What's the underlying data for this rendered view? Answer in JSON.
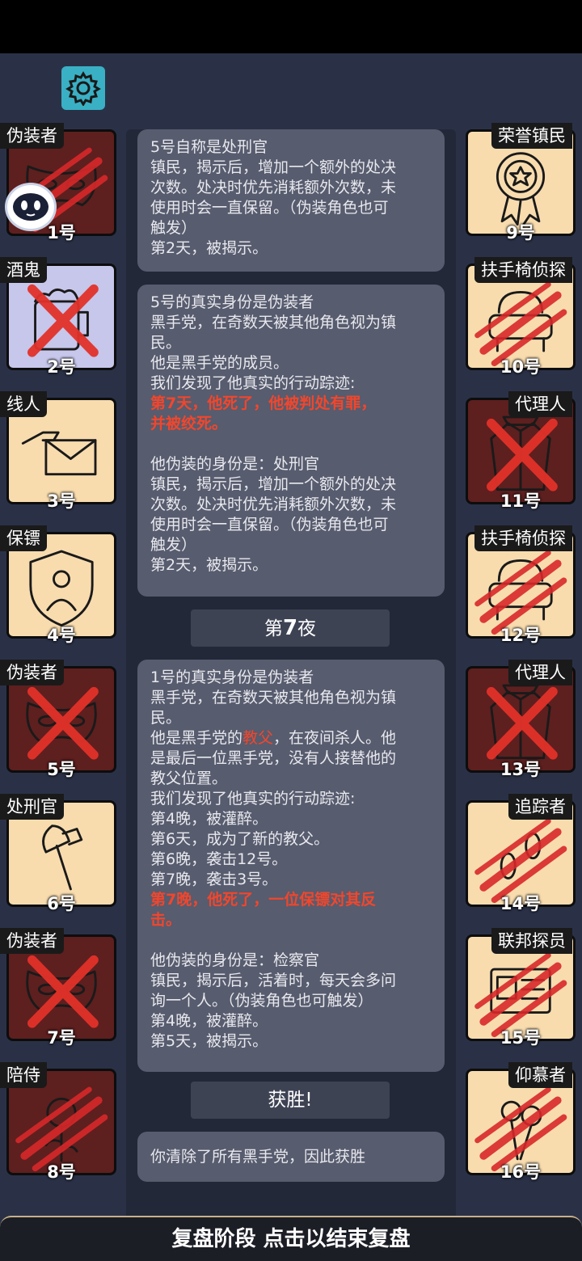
{
  "left_players": [
    {
      "role": "伪装者",
      "number": "1号",
      "state": "dead",
      "icon": "mask-icon",
      "mark": "claw"
    },
    {
      "role": "酒鬼",
      "number": "2号",
      "state": "drunk",
      "icon": "beer-mug-icon",
      "mark": "x"
    },
    {
      "role": "线人",
      "number": "3号",
      "state": "alive",
      "icon": "envelope-hand-icon",
      "mark": "none"
    },
    {
      "role": "保镖",
      "number": "4号",
      "state": "alive",
      "icon": "shield-person-icon",
      "mark": "none"
    },
    {
      "role": "伪装者",
      "number": "5号",
      "state": "dead",
      "icon": "mask-icon",
      "mark": "x"
    },
    {
      "role": "处刑官",
      "number": "6号",
      "state": "alive",
      "icon": "axe-icon",
      "mark": "none"
    },
    {
      "role": "伪装者",
      "number": "7号",
      "state": "dead",
      "icon": "mask-icon",
      "mark": "x"
    },
    {
      "role": "陪侍",
      "number": "8号",
      "state": "dead",
      "icon": "rose-icon",
      "mark": "claw"
    }
  ],
  "right_players": [
    {
      "role": "荣誉镇民",
      "number": "9号",
      "state": "alive",
      "icon": "medal-icon",
      "mark": "none"
    },
    {
      "role": "扶手椅侦探",
      "number": "10号",
      "state": "alive",
      "icon": "armchair-icon",
      "mark": "claw"
    },
    {
      "role": "代理人",
      "number": "11号",
      "state": "dead",
      "icon": "coat-icon",
      "mark": "x"
    },
    {
      "role": "扶手椅侦探",
      "number": "12号",
      "state": "alive",
      "icon": "armchair-icon",
      "mark": "claw"
    },
    {
      "role": "代理人",
      "number": "13号",
      "state": "dead",
      "icon": "coat-icon",
      "mark": "x"
    },
    {
      "role": "追踪者",
      "number": "14号",
      "state": "alive",
      "icon": "footprints-icon",
      "mark": "claw"
    },
    {
      "role": "联邦探员",
      "number": "15号",
      "state": "alive",
      "icon": "badge-icon",
      "mark": "claw"
    },
    {
      "role": "仰慕者",
      "number": "16号",
      "state": "alive",
      "icon": "flowers-icon",
      "mark": "claw"
    }
  ],
  "log": {
    "bubble1": [
      "5号自称是处刑官",
      "镇民，揭示后，增加一个额外的处决",
      "次数。处决时优先消耗额外次数，未",
      "使用时会一直保留。（伪装角色也可",
      "触发）",
      "第2天，被揭示。"
    ],
    "bubble2_top": [
      "5号的真实身份是伪装者",
      "黑手党，在奇数天被其他角色视为镇",
      "民。",
      "他是黑手党的成员。",
      "我们发现了他真实的行动踪迹:"
    ],
    "bubble2_red": [
      "第7天，他死了，他被判处有罪，",
      "并被绞死。"
    ],
    "bubble2_bottom": [
      "他伪装的身份是：处刑官",
      "镇民，揭示后，增加一个额外的处决",
      "次数。处决时优先消耗额外次数，未",
      "使用时会一直保留。（伪装角色也可",
      "触发）",
      "第2天，被揭示。"
    ],
    "night_prefix": "第",
    "night_num": "7",
    "night_suffix": "夜",
    "bubble3_a": [
      "1号的真实身份是伪装者",
      "黑手党，在奇数天被其他角色视为镇",
      "民。"
    ],
    "bubble3_b1": "他是黑手党的",
    "bubble3_b2": "教父",
    "bubble3_b3": "，在夜间杀人。他",
    "bubble3_c": [
      "是最后一位黑手党，没有人接替他的",
      "教父位置。",
      "我们发现了他真实的行动踪迹:",
      "第4晚，被灌醉。",
      "第6天，成为了新的教父。",
      "第6晚，袭击12号。",
      "第7晚，袭击3号。"
    ],
    "bubble3_red": [
      "第7晚，他死了，一位保镖对其反",
      "击。"
    ],
    "bubble3_d": [
      "他伪装的身份是：检察官",
      "镇民，揭示后，活着时，每天会多问",
      "询一个人。（伪装角色也可触发）",
      "第4晚，被灌醉。",
      "第5天，被揭示。"
    ],
    "victory_label": "获胜!",
    "victory_text": "你清除了所有黑手党，因此获胜"
  },
  "bottom_bar": "复盘阶段 点击以结束复盘",
  "colors": {
    "accent_red": "#f2462c",
    "dead_card": "#5e1f1f",
    "alive_card": "#f8dcae",
    "background": "#2a3147"
  }
}
